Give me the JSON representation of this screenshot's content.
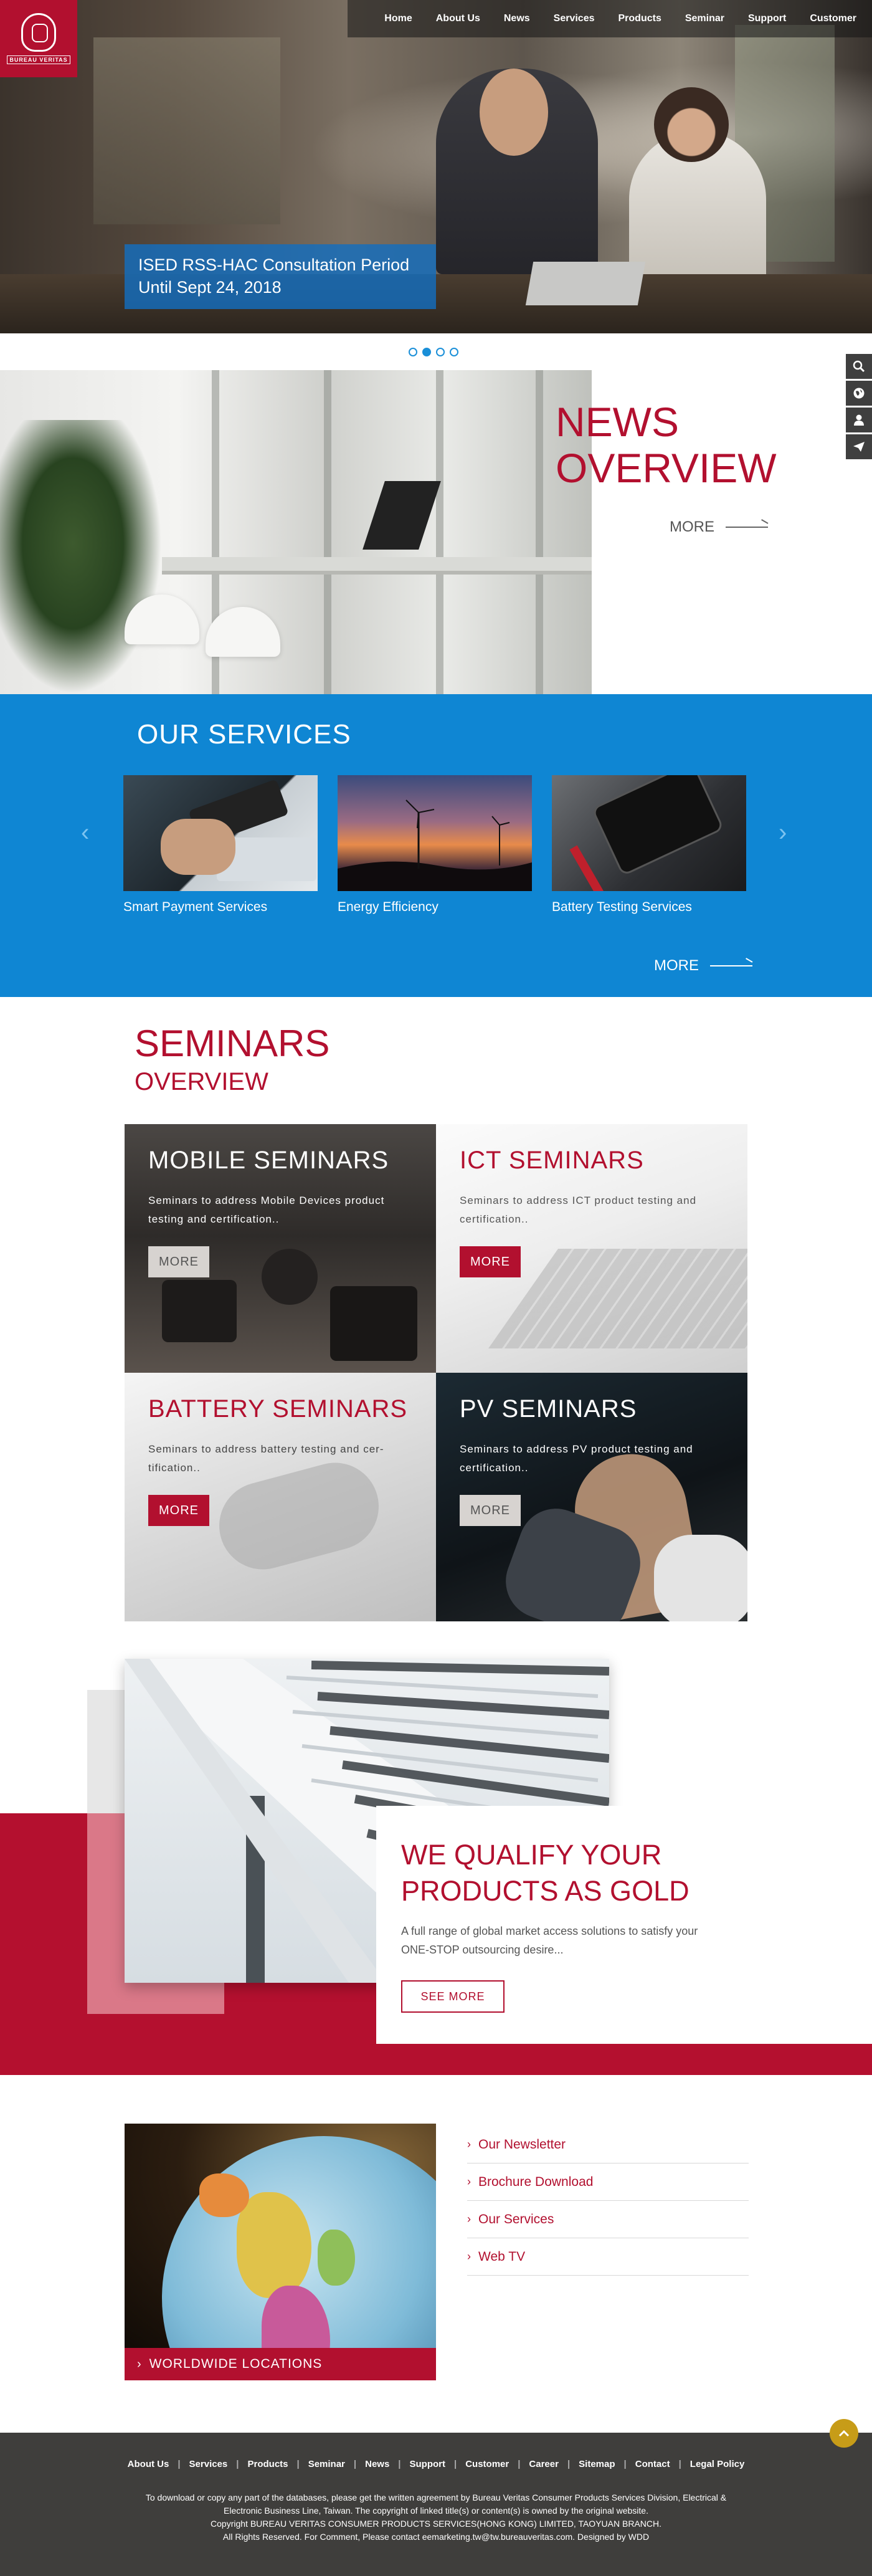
{
  "header": {
    "logo_text": "BUREAU VERITAS",
    "nav": [
      "Home",
      "About Us",
      "News",
      "Services",
      "Products",
      "Seminar",
      "Support",
      "Customer"
    ]
  },
  "hero": {
    "caption_line1": "ISED RSS-HAC Consultation Period",
    "caption_line2": "Until Sept 24, 2018",
    "slide_count": 4,
    "active_slide": 2
  },
  "side_tools": [
    "search-icon",
    "globe-icon",
    "user-icon",
    "send-icon"
  ],
  "news": {
    "title_line1": "NEWS",
    "title_line2": "OVERVIEW",
    "more_label": "MORE"
  },
  "services": {
    "title": "OUR SERVICES",
    "items": [
      {
        "label": "Smart Payment Services"
      },
      {
        "label": "Energy Efficiency"
      },
      {
        "label": "Battery Testing Services"
      }
    ],
    "prev_icon": "chevron-left-icon",
    "next_icon": "chevron-right-icon",
    "more_label": "MORE"
  },
  "seminars": {
    "title": "SEMINARS",
    "subtitle": "OVERVIEW",
    "cards": [
      {
        "title": "MOBILE SEMINARS",
        "desc": "Seminars to address Mobile Devices product testing and certification..",
        "button": "MORE"
      },
      {
        "title": "ICT SEMINARS",
        "desc": "Seminars to address ICT product testing and certification..",
        "button": "MORE"
      },
      {
        "title": "BATTERY SEMINARS",
        "desc": "Seminars to address battery testing and cer-tification..",
        "button": "MORE"
      },
      {
        "title": "PV SEMINARS",
        "desc": "Seminars to address PV product testing and certification..",
        "button": "MORE"
      }
    ]
  },
  "qualify": {
    "title_line1": "WE QUALIFY YOUR",
    "title_line2": "PRODUCTS AS GOLD",
    "desc": "A full range of global market access solutions to satisfy your ONE-STOP outsourcing desire...",
    "button": "SEE MORE"
  },
  "locations": {
    "caption": "WORLDWIDE LOCATIONS"
  },
  "quick_links": [
    "Our Newsletter",
    "Brochure Download",
    "Our Services",
    "Web TV"
  ],
  "footer": {
    "nav": [
      "About Us",
      "Services",
      "Products",
      "Seminar",
      "News",
      "Support",
      "Customer",
      "Career",
      "Sitemap",
      "Contact",
      "Legal Policy"
    ],
    "text_line1": "To download or copy any part of the databases, please get the written agreement by Bureau Veritas Consumer Products Services Division, Electrical &",
    "text_line2": "Electronic Business Line, Taiwan. The copyright of linked title(s) or content(s) is owned by the original website.",
    "text_line3": "Copyright BUREAU VERITAS CONSUMER PRODUCTS SERVICES(HONG KONG) LIMITED, TAOYUAN BRANCH.",
    "text_line4": "All Rights Reserved. For Comment, Please contact eemarketing.tw@tw.bureauveritas.com. Designed by WDD"
  },
  "colors": {
    "brand_red": "#b2102f",
    "services_blue": "#0f86d3",
    "footer_dark": "#3f3e3c",
    "to_top_gold": "#c79c18"
  }
}
